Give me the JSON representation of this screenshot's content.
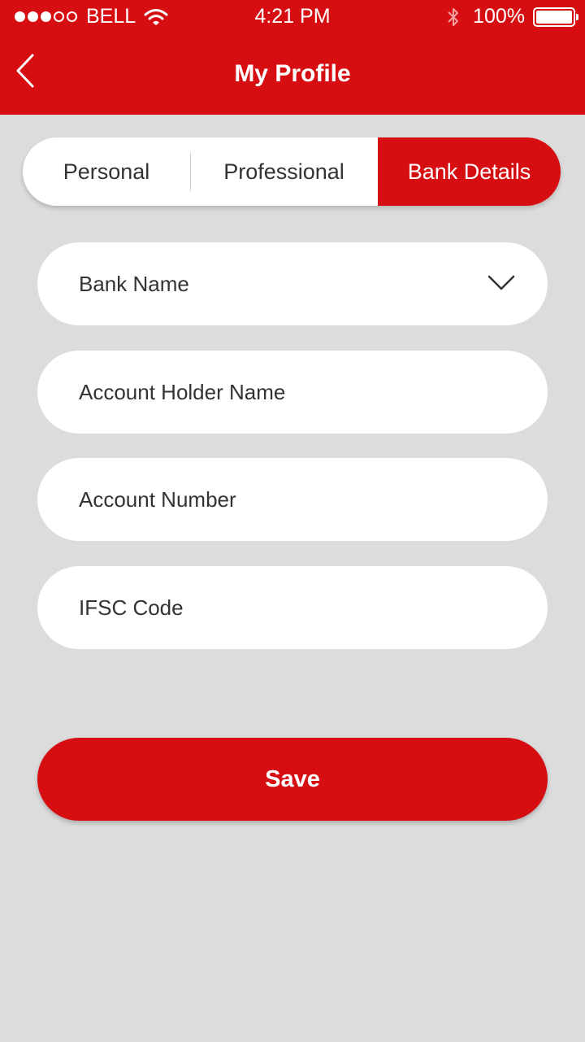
{
  "status_bar": {
    "carrier": "BELL",
    "time": "4:21 PM",
    "battery": "100%",
    "signal_bars_filled": 3,
    "signal_bars_total": 5
  },
  "header": {
    "title": "My Profile",
    "back_icon": "chevron-left-icon"
  },
  "tabs": [
    {
      "label": "Personal",
      "active": false
    },
    {
      "label": "Professional",
      "active": false
    },
    {
      "label": "Bank Details",
      "active": true
    }
  ],
  "form": {
    "bank_name": "Bank Name",
    "account_holder_name": "Account Holder Name",
    "account_number": "Account Number",
    "ifsc_code": "IFSC Code"
  },
  "save_label": "Save",
  "colors": {
    "accent": "#d60e11",
    "background": "#dcdcdc",
    "field": "#ffffff"
  }
}
